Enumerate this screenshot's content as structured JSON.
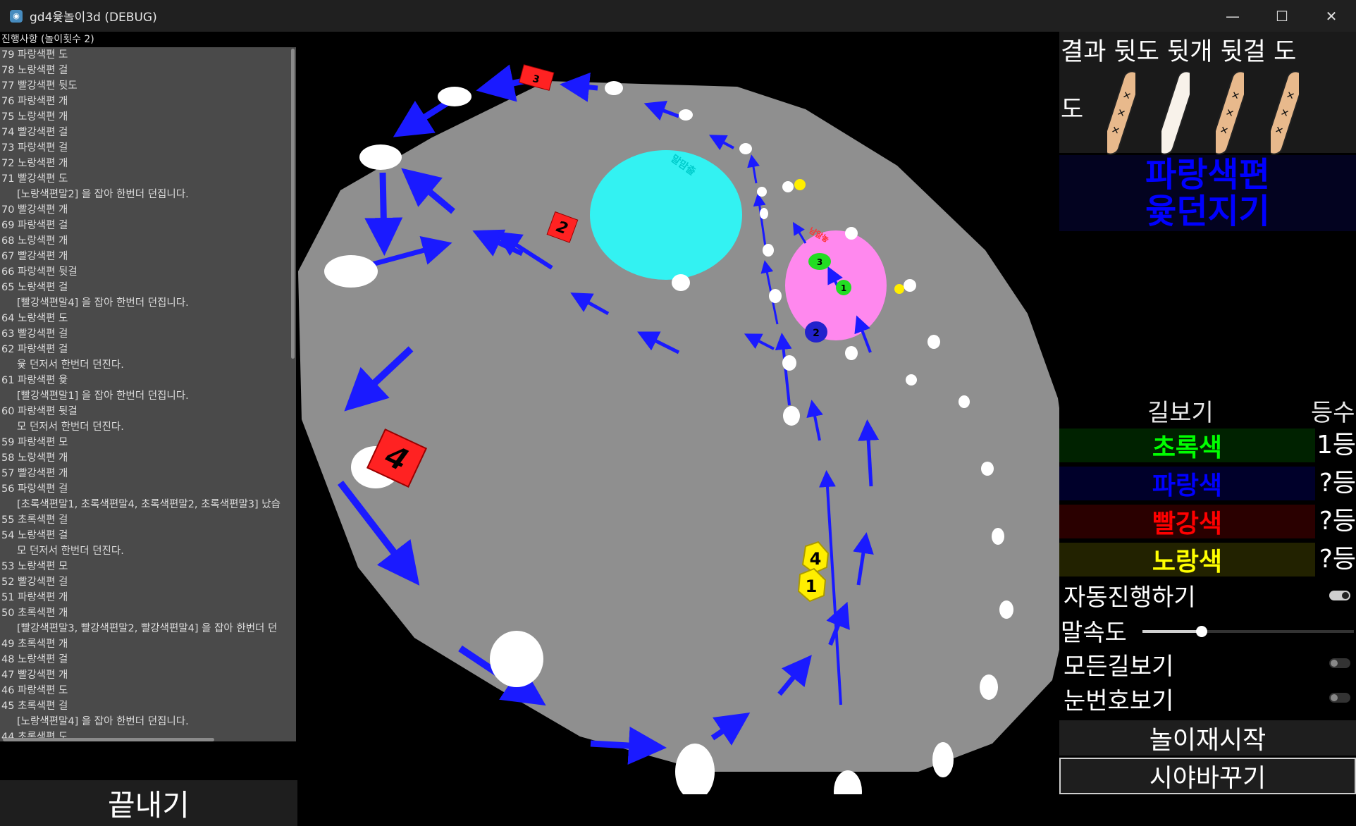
{
  "window": {
    "title": "gd4윷놀이3d (DEBUG)",
    "minimize": "—",
    "maximize": "☐",
    "close": "✕"
  },
  "log": {
    "header": "진행사항 (놀이횟수 2)",
    "lines": [
      "79 파랑색편 도",
      "78 노랑색편 걸",
      "77 빨강색편 뒷도",
      "76 파랑색편 개",
      "75 노랑색편 개",
      "74 빨강색편 걸",
      "73 파랑색편 걸",
      "72 노랑색편 개",
      "71 빨강색편 도",
      "[노랑색편말2] 을 잡아 한번더 던집니다.",
      "70 빨강색편 개",
      "69 파랑색편 걸",
      "68 노랑색편 개",
      "67 빨강색편 개",
      "66 파랑색편 뒷걸",
      "65 노랑색편 걸",
      "[빨강색편말4] 을 잡아 한번더 던집니다.",
      "64 노랑색편 도",
      "63 빨강색편 걸",
      "62 파랑색편 걸",
      "윷 던저서 한번더 던진다.",
      "61 파랑색편 윷",
      "[빨강색편말1] 을 잡아 한번더 던집니다.",
      "60 파랑색편 뒷걸",
      "모 던저서 한번더 던진다.",
      "59 파랑색편 모",
      "58 노랑색편 개",
      "57 빨강색편 개",
      "56 파랑색편 걸",
      "[초록색편말1, 초록색편말4, 초록색편말2, 초록색편말3] 났습",
      "55 초록색편 걸",
      "54 노랑색편 걸",
      "모 던저서 한번더 던진다.",
      "53 노랑색편 모",
      "52 빨강색편 걸",
      "51 파랑색편 개",
      "50 초록색편 개",
      "[빨강색편말3, 빨강색편말2, 빨강색편말4] 을 잡아 한번더 던",
      "49 초록색편 개",
      "48 노랑색편 걸",
      "47 빨강색편 개",
      "46 파랑색편 도",
      "45 초록색편 걸",
      "[노랑색편말4] 을 잡아 한번더 던집니다.",
      "44 초록색편 도"
    ],
    "quit_label": "끝내기"
  },
  "board": {
    "green_zone_label": "말맘출",
    "pink_zone_label": "남말놓",
    "piece_labels": {
      "red_big": "4",
      "red_small": "2",
      "red_top": "3",
      "yellow_1": "1",
      "yellow_4": "4",
      "green_1": "1",
      "green_34": "3",
      "blue": "2"
    }
  },
  "result": {
    "label": "결과 뒷도 뒷개 뒷걸 도",
    "value": "도"
  },
  "turn": {
    "line1": "파랑색편",
    "line2": "윷던지기"
  },
  "table": {
    "path_header": "길보기",
    "rank_header": "등수",
    "players": [
      {
        "name": "초록색",
        "rank": "1등",
        "color": "#00ff00",
        "bg": "#002200"
      },
      {
        "name": "파랑색",
        "rank": "?등",
        "color": "#0000ff",
        "bg": "#00002a"
      },
      {
        "name": "빨강색",
        "rank": "?등",
        "color": "#ff0000",
        "bg": "#2a0000"
      },
      {
        "name": "노랑색",
        "rank": "?등",
        "color": "#ffff00",
        "bg": "#222200"
      }
    ]
  },
  "options": {
    "auto_play": "자동진행하기",
    "auto_play_on": true,
    "piece_speed": "말속도",
    "piece_speed_value": 0.28,
    "show_all_paths": "모든길보기",
    "show_all_paths_on": false,
    "show_spot_numbers": "눈번호보기",
    "show_spot_numbers_on": false
  },
  "buttons": {
    "restart": "놀이재시작",
    "change_view": "시야바꾸기"
  }
}
